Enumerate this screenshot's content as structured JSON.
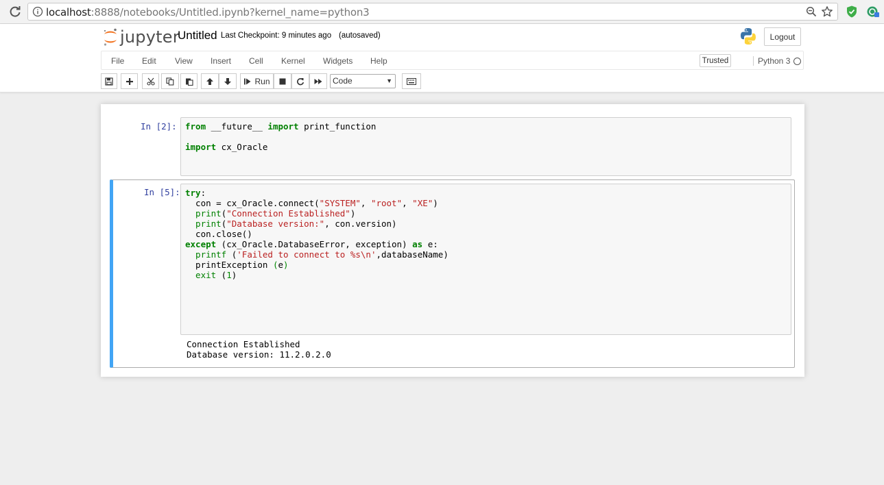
{
  "browser": {
    "url_host": "localhost",
    "url_rest": ":8888/notebooks/Untitled.ipynb?kernel_name=python3"
  },
  "header": {
    "logo_text": "jupyter",
    "notebook_title": "Untitled",
    "checkpoint": "Last Checkpoint: 9 minutes ago",
    "autosave": "(autosaved)",
    "logout_label": "Logout"
  },
  "menubar": {
    "items": [
      "File",
      "Edit",
      "View",
      "Insert",
      "Cell",
      "Kernel",
      "Widgets",
      "Help"
    ],
    "trusted_label": "Trusted",
    "kernel_name": "Python 3"
  },
  "toolbar": {
    "run_label": "Run",
    "cell_type": "Code"
  },
  "cells": [
    {
      "prompt": "In [2]:",
      "code": [
        [
          [
            "kw",
            "from"
          ],
          [
            "",
            " __future__ "
          ],
          [
            "kw",
            "import"
          ],
          [
            "",
            " print_function"
          ]
        ],
        [],
        [
          [
            "kw",
            "import"
          ],
          [
            "",
            " cx_Oracle"
          ]
        ]
      ]
    },
    {
      "prompt": "In [5]:",
      "code": [
        [
          [
            "kw",
            "try"
          ],
          [
            "",
            ":"
          ]
        ],
        [
          [
            "",
            "  con = cx_Oracle.connect("
          ],
          [
            "str",
            "\"SYSTEM\""
          ],
          [
            "",
            ", "
          ],
          [
            "str",
            "\"root\""
          ],
          [
            "",
            ", "
          ],
          [
            "str",
            "\"XE\""
          ],
          [
            "",
            ")"
          ]
        ],
        [
          [
            "bi",
            "  print"
          ],
          [
            "",
            "("
          ],
          [
            "str",
            "\"Connection Established\""
          ],
          [
            "",
            ")"
          ]
        ],
        [
          [
            "bi",
            "  print"
          ],
          [
            "",
            "("
          ],
          [
            "str",
            "\"Database version:\""
          ],
          [
            "",
            ", con.version)"
          ]
        ],
        [
          [
            "",
            "  con.close()"
          ]
        ],
        [
          [
            "kw",
            "except"
          ],
          [
            "",
            " (cx_Oracle.DatabaseError, exception) "
          ],
          [
            "kw",
            "as"
          ],
          [
            "",
            " e:"
          ]
        ],
        [
          [
            "bi",
            "  printf"
          ],
          [
            "",
            " ("
          ],
          [
            "str",
            "'Failed to connect to %s\\n'"
          ],
          [
            "",
            ",databaseName)"
          ]
        ],
        [
          [
            "",
            "  printException "
          ],
          [
            "num",
            "("
          ],
          [
            "",
            "e"
          ],
          [
            "num",
            ")"
          ]
        ],
        [
          [
            "bi",
            "  exit"
          ],
          [
            "",
            " ("
          ],
          [
            "num",
            "1"
          ],
          [
            "",
            ")"
          ]
        ]
      ],
      "output": [
        "Connection Established",
        "Database version: 11.2.0.2.0"
      ]
    }
  ]
}
